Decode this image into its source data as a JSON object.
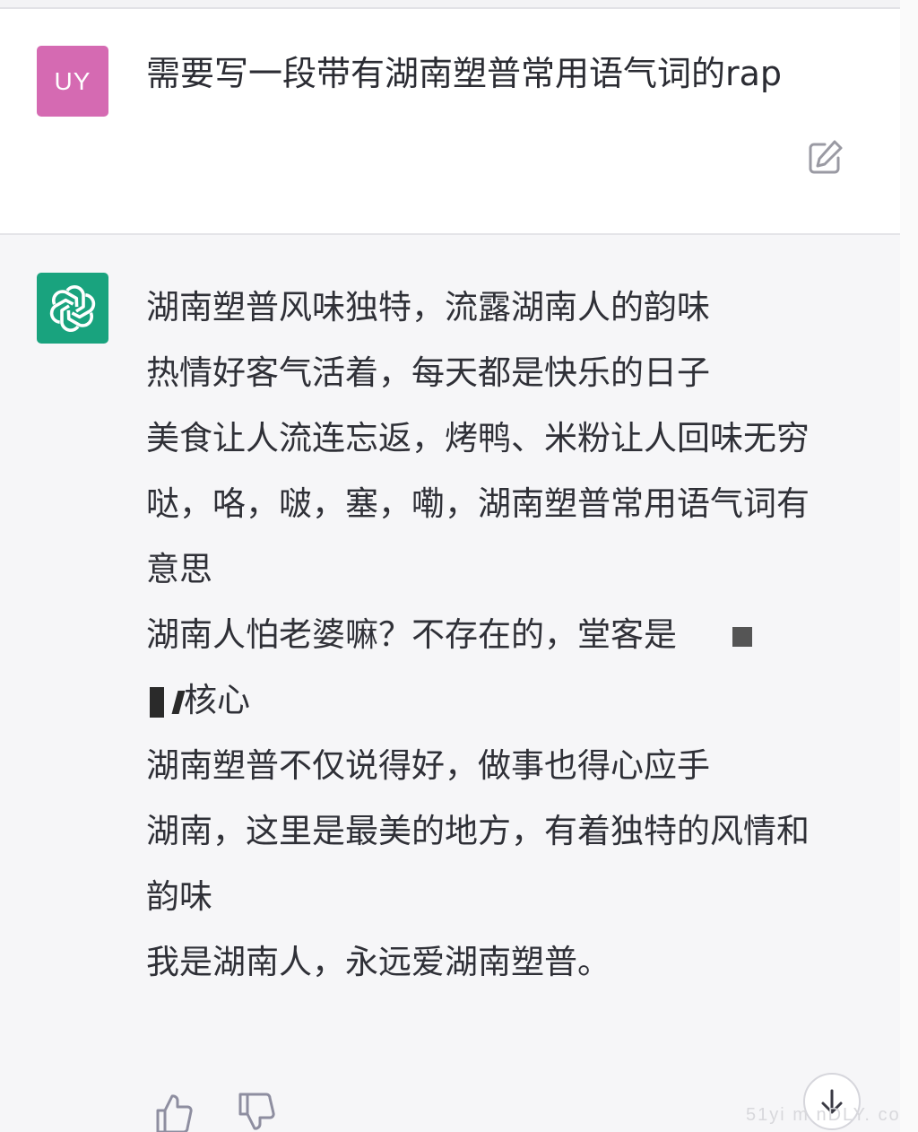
{
  "conversation": {
    "user": {
      "avatar_initials": "UY",
      "avatar_color": "#d56ab2",
      "message": "需要写一段带有湖南塑普常用语气词的rap",
      "edit_icon": "edit-icon"
    },
    "assistant": {
      "avatar_icon": "openai-logo-icon",
      "avatar_color": "#19a37e",
      "lines": [
        "湖南塑普风味独特，流露湖南人的韵味",
        "热情好客气活着，每天都是快乐的日子",
        "美食让人流连忘返，烤鸭、米粉让人回味无穷",
        "哒，咯，啵，塞，嘞，湖南塑普常用语气词有意思",
        "湖南人怕老婆嘛？不存在的，堂客是",
        "核心",
        "湖南塑普不仅说得好，做事也得心应手",
        "湖南，这里是最美的地方，有着独特的风情和韵味",
        "我是湖南人，永远爱湖南塑普。"
      ]
    },
    "feedback": {
      "thumbs_up_icon": "thumbs-up-icon",
      "thumbs_down_icon": "thumbs-down-icon"
    },
    "scroll_button_icon": "arrow-down-icon"
  },
  "watermark": "51yi m nDLY. co"
}
